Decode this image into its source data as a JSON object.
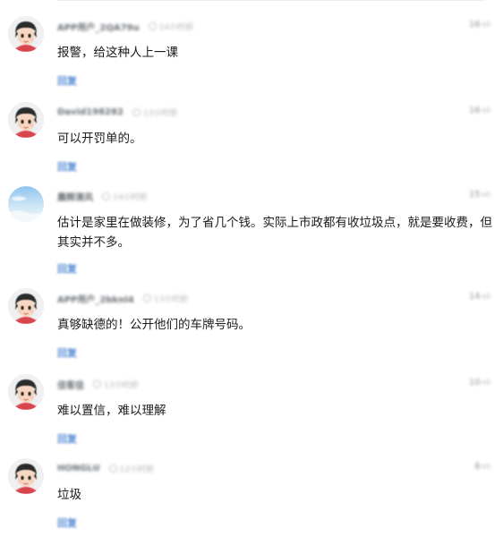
{
  "comments": [
    {
      "username": "APP用户_2QA79u",
      "time": "14小时前",
      "likes": "16",
      "text": "报警，给这种人上一课",
      "reply_label": "回复",
      "avatar": "cartoon-boy"
    },
    {
      "username": "David198282",
      "time": "13小时前",
      "likes": "16",
      "text": "可以开罚单的。",
      "reply_label": "回复",
      "avatar": "cartoon-boy"
    },
    {
      "username": "晨辉清风",
      "time": "14小时前",
      "likes": "15",
      "text": "估计是家里在做装修，为了省几个钱。实际上市政都有收垃圾点，就是要收费，但其实并不多。",
      "reply_label": "回复",
      "avatar": "sky-landscape"
    },
    {
      "username": "APP用户_2bknl4",
      "time": "13小时前",
      "likes": "14",
      "text": "真够缺德的！公开他们的车牌号码。",
      "reply_label": "回复",
      "avatar": "cartoon-boy"
    },
    {
      "username": "佳客佳",
      "time": "13小时前",
      "likes": "10",
      "text": "难以置信，难以理解",
      "reply_label": "回复",
      "avatar": "cartoon-boy"
    },
    {
      "username": "HONGLU",
      "time": "12小时前",
      "likes": "8",
      "text": "垃圾",
      "reply_label": "回复",
      "avatar": "cartoon-boy"
    }
  ],
  "colors": {
    "reply_link": "#5a8fd6",
    "username": "#6a6f75",
    "body_text": "#1b1b1b"
  }
}
